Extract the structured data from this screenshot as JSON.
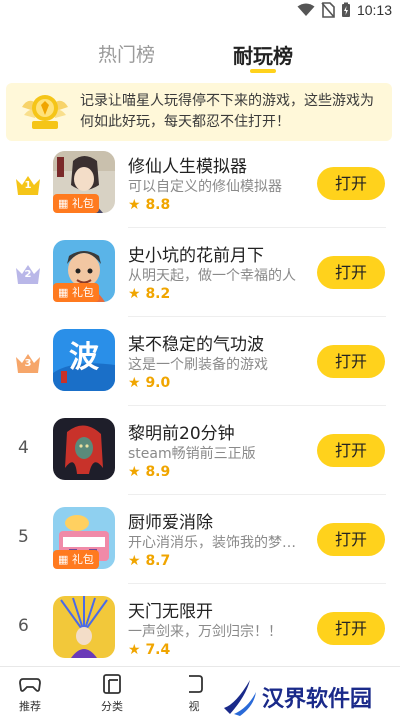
{
  "status_bar": {
    "time": "10:13"
  },
  "tabs": [
    {
      "label": "热门榜",
      "active": false
    },
    {
      "label": "耐玩榜",
      "active": true
    }
  ],
  "banner": {
    "text": "记录让喵星人玩得停不下来的游戏，这些游戏为何如此好玩，每天都忍不住打开！"
  },
  "games": [
    {
      "rank": "1",
      "name": "修仙人生模拟器",
      "desc": "可以自定义的修仙模拟器",
      "rating": "8.8",
      "gift": "礼包",
      "button": "打开"
    },
    {
      "rank": "2",
      "name": "史小坑的花前月下",
      "desc": "从明天起，做一个幸福的人",
      "rating": "8.2",
      "gift": "礼包",
      "button": "打开"
    },
    {
      "rank": "3",
      "name": "某不稳定的气功波",
      "desc": "这是一个刷装备的游戏",
      "rating": "9.0",
      "gift": "",
      "button": "打开"
    },
    {
      "rank": "4",
      "name": "黎明前20分钟",
      "desc": "steam畅销前三正版",
      "rating": "8.9",
      "gift": "",
      "button": "打开"
    },
    {
      "rank": "5",
      "name": "厨师爱消除",
      "desc": "开心消消乐，装饰我的梦幻...",
      "rating": "8.7",
      "gift": "礼包",
      "button": "打开"
    },
    {
      "rank": "6",
      "name": "天门无限开",
      "desc": "一声剑来，万剑归宗！！",
      "rating": "7.4",
      "gift": "",
      "button": "打开"
    }
  ],
  "bottom_nav": [
    {
      "label": "推荐",
      "icon": "gamepad-icon"
    },
    {
      "label": "分类",
      "icon": "category-icon"
    },
    {
      "label": "视",
      "icon": "video-icon"
    }
  ],
  "watermark": {
    "text": "汉界软件园"
  },
  "colors": {
    "accent": "#ffd21c",
    "gift": "#ff7a1f",
    "rating": "#f0a500",
    "gold_crown": "#f5c518",
    "silver_crown": "#b9b7e8",
    "bronze_crown": "#f6a66a"
  }
}
